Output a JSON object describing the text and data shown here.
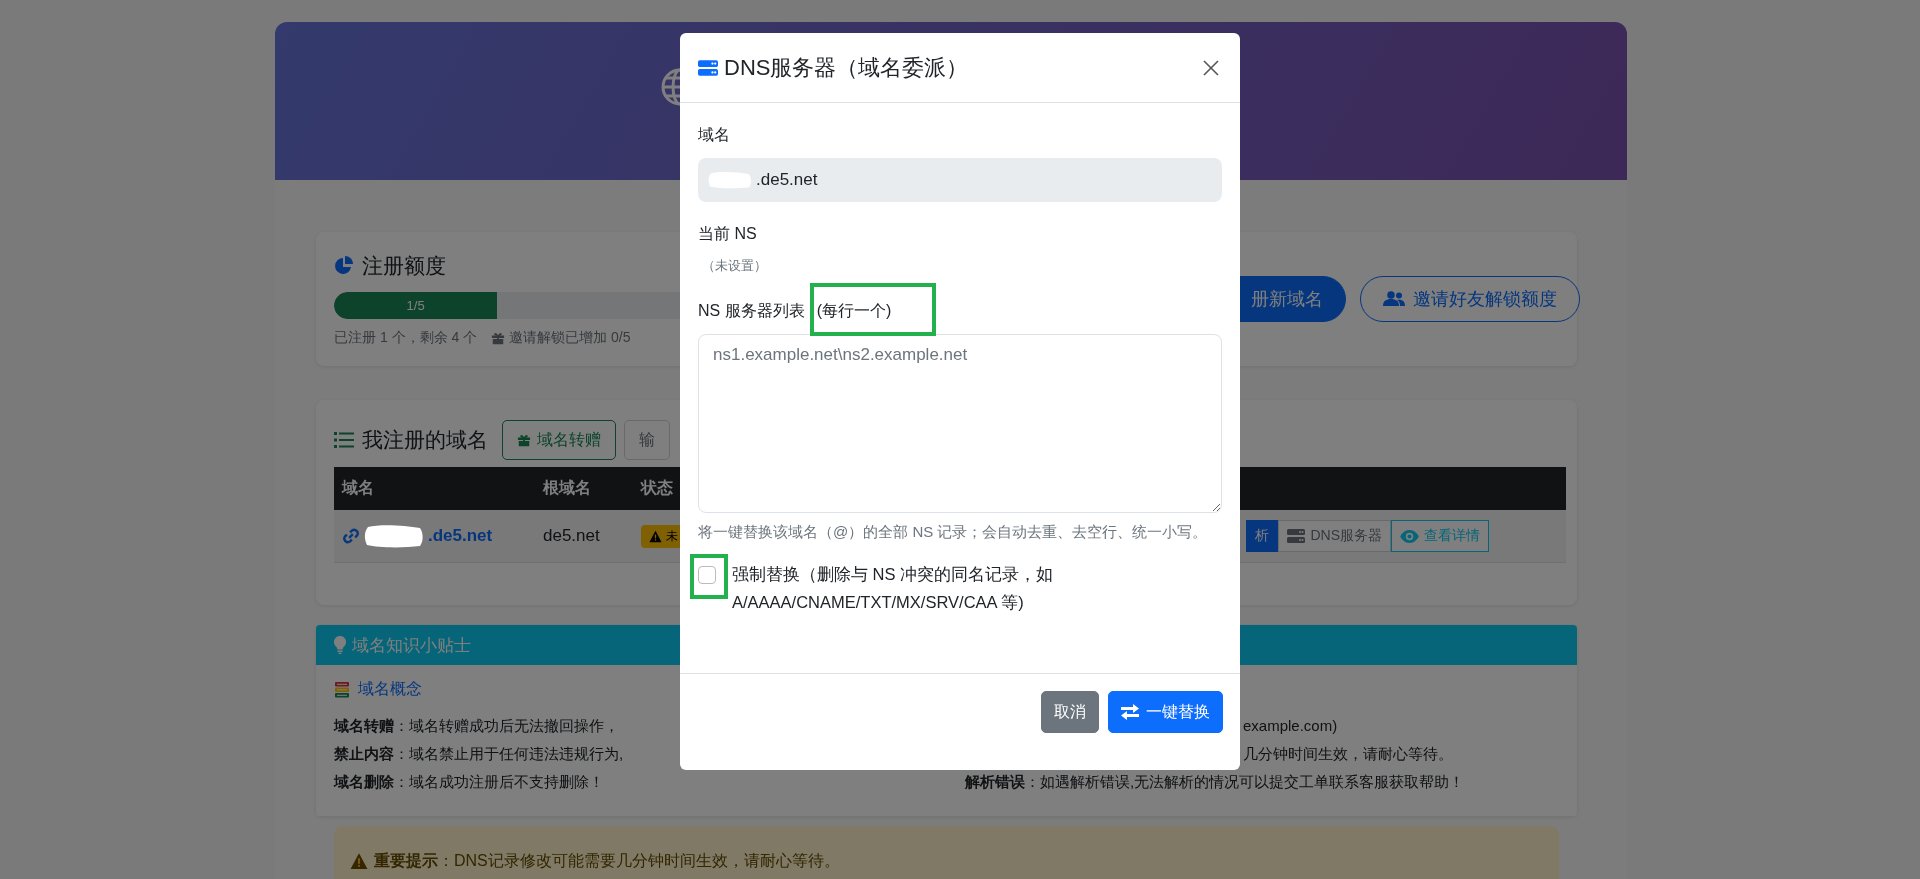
{
  "quota": {
    "title": "注册额度",
    "progress": {
      "label": "1/5",
      "level": 0.2
    },
    "summary": "已注册 1 个，剩余 4 个",
    "invite_note": "邀请解锁已增加 0/5",
    "buttons": [
      {
        "label": "册新域名",
        "kind": "primary"
      },
      {
        "label": "邀请好友解锁额度",
        "kind": "outline"
      }
    ]
  },
  "domains": {
    "title": "我注册的域名",
    "actions": [
      {
        "label": "域名转赠",
        "kind": "success"
      },
      {
        "label": "输",
        "kind": "secondary"
      }
    ],
    "columns": [
      "域名",
      "根域名",
      "状态"
    ],
    "rows": [
      {
        "domain": ".de5.net",
        "root": "de5.net",
        "status": "未",
        "actions": [
          {
            "label": "析",
            "kind": "primary"
          },
          {
            "label": "DNS服务器",
            "kind": "secondary"
          },
          {
            "label": "查看详情",
            "kind": "info"
          }
        ]
      }
    ]
  },
  "tips": {
    "title": "域名知识小贴士",
    "concept": "域名概念",
    "left": [
      {
        "term": "域名转赠",
        "text": "：域名转赠成功后无法撤回操作，"
      },
      {
        "term": "禁止内容",
        "text": "：域名禁止用于任何违法违规行为,"
      },
      {
        "term": "域名删除",
        "text": "：域名成功注册后不支持删除！"
      }
    ],
    "right": [
      {
        "text": "example.com)"
      },
      {
        "text": "几分钟时间生效，请耐心等待。"
      },
      {
        "term": "解析错误",
        "text": "：如遇解析错误,无法解析的情况可以提交工单联系客服获取帮助！"
      }
    ]
  },
  "alert": {
    "title": "重要提示",
    "text": "：DNS记录修改可能需要几分钟时间生效，请耐心等待。"
  },
  "modal": {
    "title": "DNS服务器（域名委派）",
    "domain_label": "域名",
    "domain_value": ".de5.net",
    "current_ns_label": "当前 NS",
    "current_ns_value": "（未设置）",
    "ns_list_label": "NS 服务器列表",
    "ns_list_hint": "(每行一个)",
    "ns_list_hint_highlighted": true,
    "ns_placeholder": "ns1.example.net\\ns2.example.net",
    "help": "将一键替换该域名（@）的全部 NS 记录；会自动去重、去空行、统一小写。",
    "force_replace": {
      "label": "强制替换（删除与 NS 冲突的同名记录，如 A/AAAA/CNAME/TXT/MX/SRV/CAA 等)",
      "checked": false,
      "highlighted": true
    },
    "buttons": [
      {
        "label": "取消",
        "kind": "secondary"
      },
      {
        "label": "一键替换",
        "kind": "primary"
      }
    ]
  }
}
